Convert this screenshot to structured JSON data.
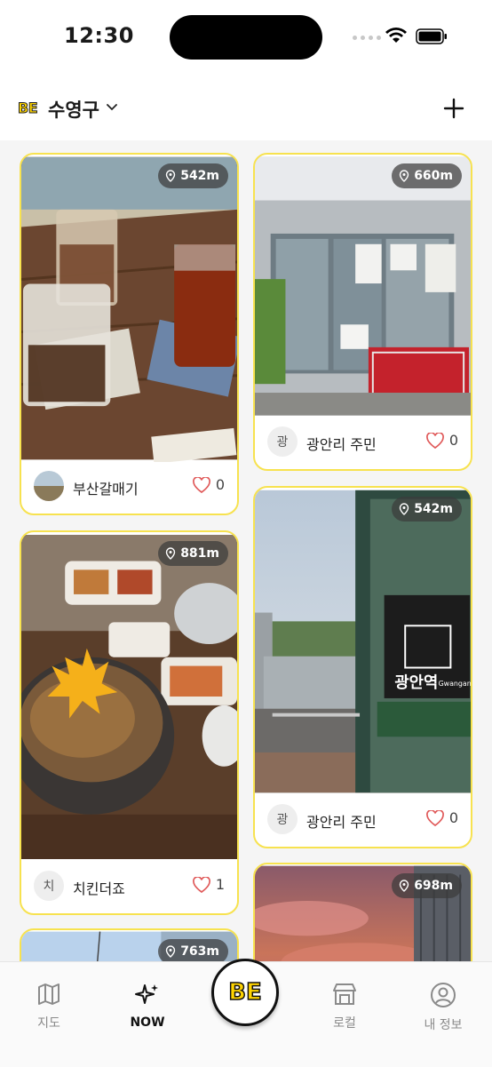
{
  "status_bar": {
    "time": "12:30"
  },
  "header": {
    "brand": "BE",
    "district": "수영구"
  },
  "posts": [
    {
      "distance": "542m",
      "user": "부산갈매기",
      "avatar_text": "",
      "likes": "0"
    },
    {
      "distance": "660m",
      "user": "광안리 주민",
      "avatar_text": "광",
      "likes": "0"
    },
    {
      "distance": "881m",
      "user": "치킨더죠",
      "avatar_text": "치",
      "likes": "1"
    },
    {
      "distance": "542m",
      "user": "광안리 주민",
      "avatar_text": "광",
      "likes": "0"
    },
    {
      "distance": "763m"
    },
    {
      "distance": "698m"
    }
  ],
  "photo_texts": {
    "station_name": "광안역",
    "station_sub": "Gwangan St"
  },
  "bottom_nav": {
    "map": "지도",
    "now": "NOW",
    "be": "BE",
    "local": "로컬",
    "my_info": "내 정보"
  },
  "colors": {
    "accent": "#ffd400",
    "card_border": "#f7e24f",
    "heart": "#e05a5a"
  }
}
